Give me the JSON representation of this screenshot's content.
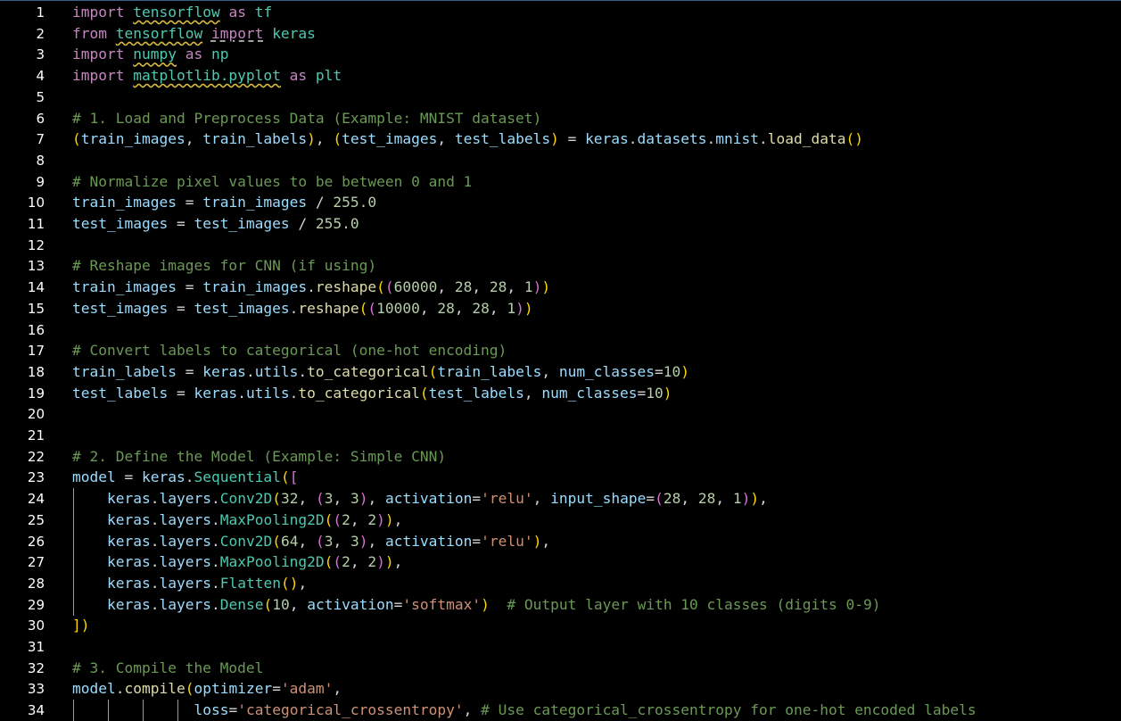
{
  "editor": {
    "language": "python",
    "line_numbers": [
      "1",
      "2",
      "3",
      "4",
      "5",
      "6",
      "7",
      "8",
      "9",
      "10",
      "11",
      "12",
      "13",
      "14",
      "15",
      "16",
      "17",
      "18",
      "19",
      "20",
      "21",
      "22",
      "23",
      "24",
      "25",
      "26",
      "27",
      "28",
      "29",
      "30",
      "31",
      "32",
      "33",
      "34"
    ],
    "lines": [
      "import tensorflow as tf",
      "from tensorflow import keras",
      "import numpy as np",
      "import matplotlib.pyplot as plt",
      "",
      "# 1. Load and Preprocess Data (Example: MNIST dataset)",
      "(train_images, train_labels), (test_images, test_labels) = keras.datasets.mnist.load_data()",
      "",
      "# Normalize pixel values to be between 0 and 1",
      "train_images = train_images / 255.0",
      "test_images = test_images / 255.0",
      "",
      "# Reshape images for CNN (if using)",
      "train_images = train_images.reshape((60000, 28, 28, 1))",
      "test_images = test_images.reshape((10000, 28, 28, 1))",
      "",
      "# Convert labels to categorical (one-hot encoding)",
      "train_labels = keras.utils.to_categorical(train_labels, num_classes=10)",
      "test_labels = keras.utils.to_categorical(test_labels, num_classes=10)",
      "",
      "",
      "# 2. Define the Model (Example: Simple CNN)",
      "model = keras.Sequential([",
      "    keras.layers.Conv2D(32, (3, 3), activation='relu', input_shape=(28, 28, 1)),",
      "    keras.layers.MaxPooling2D((2, 2)),",
      "    keras.layers.Conv2D(64, (3, 3), activation='relu'),",
      "    keras.layers.MaxPooling2D((2, 2)),",
      "    keras.layers.Flatten(),",
      "    keras.layers.Dense(10, activation='softmax')  # Output layer with 10 classes (digits 0-9)",
      "])",
      "",
      "# 3. Compile the Model",
      "model.compile(optimizer='adam',",
      "              loss='categorical_crossentropy', # Use categorical_crossentropy for one-hot encoded labels"
    ],
    "squiggle_tokens": [
      "tensorflow",
      "numpy",
      "matplotlib.pyplot"
    ],
    "theme": {
      "background": "#000000",
      "keyword": "#c586c0",
      "variable": "#9cdcfe",
      "function": "#dcdcaa",
      "class": "#4ec9b0",
      "number": "#b5cea8",
      "string": "#ce9178",
      "comment": "#6a9955",
      "bracket_level1": "#ffd700",
      "bracket_level2": "#da70d6",
      "bracket_level3": "#179fff",
      "warning_squiggle": "#d7ba3d"
    }
  }
}
